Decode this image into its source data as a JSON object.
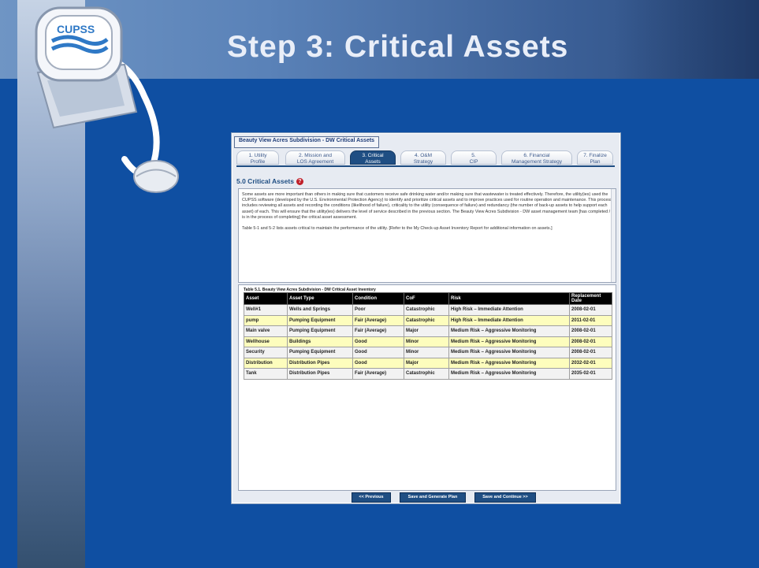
{
  "slide": {
    "title": "Step 3: Critical Assets",
    "logo_text": "CUPSS"
  },
  "app": {
    "title": "Beauty View Acres Subdivision - DW Critical Assets",
    "tabs": [
      {
        "line1": "1. Utility",
        "line2": "Profile",
        "active": false
      },
      {
        "line1": "2. Mission and",
        "line2": "LOS Agreement",
        "active": false
      },
      {
        "line1": "3. Critical",
        "line2": "Assets",
        "active": true
      },
      {
        "line1": "4. O&M",
        "line2": "Strategy",
        "active": false
      },
      {
        "line1": "5.",
        "line2": "CIP",
        "active": false
      },
      {
        "line1": "6. Financial",
        "line2": "Management Strategy",
        "active": false
      },
      {
        "line1": "7. Finalize",
        "line2": "Plan",
        "active": false
      }
    ],
    "section_heading": "5.0 Critical Assets",
    "info_icon": "?",
    "paragraph1": "Some assets are more important than others in making sure that customers receive safe drinking water and/or making sure that wastewater is treated effectively. Therefore, the utility(ies) used the CUPSS software (developed by the U.S. Environmental Protection Agency) to identify and prioritize critical assets and to improve practices used for routine operation and maintenance. This process includes reviewing all assets and recording the conditions (likelihood of failure), criticality to the utility (consequence of failure) and redundancy (the number of back-up assets to help support each asset) of each. This will ensure that the utility(ies) delivers the level of service described in the previous section. The Beauty View Acres Subdivision - DW asset management team [has completed / is in the process of completing] the critical asset assessment.",
    "paragraph2": "Table 5-1 and 5-2 lists assets critical to maintain the performance of the utility. [Refer to the My Check-up Asset Inventory Report for additional information on assets.]",
    "table_caption": "Table 5.1. Beauty View Acres Subdivision - DW Critical Asset Inventory",
    "table_headers": [
      "Asset",
      "Asset Type",
      "Condition",
      "CoF",
      "Risk",
      "Replacement Date"
    ],
    "table_rows": [
      [
        "Well#1",
        "Wells and Springs",
        "Poor",
        "Catastrophic",
        "High Risk – Immediate Attention",
        "2008-02-01"
      ],
      [
        "pump",
        "Pumping Equipment",
        "Fair (Average)",
        "Catastrophic",
        "High Risk – Immediate Attention",
        "2011-02-01"
      ],
      [
        "Main valve",
        "Pumping Equipment",
        "Fair (Average)",
        "Major",
        "Medium Risk – Aggressive Monitoring",
        "2008-02-01"
      ],
      [
        "Wellhouse",
        "Buildings",
        "Good",
        "Minor",
        "Medium Risk – Aggressive Monitoring",
        "2008-02-01"
      ],
      [
        "Security",
        "Pumping Equipment",
        "Good",
        "Minor",
        "Medium Risk – Aggressive Monitoring",
        "2008-02-01"
      ],
      [
        "Distribution",
        "Distribution Pipes",
        "Good",
        "Major",
        "Medium Risk – Aggressive Monitoring",
        "2032-02-01"
      ],
      [
        "Tank",
        "Distribution Pipes",
        "Fair (Average)",
        "Catastrophic",
        "Medium Risk – Aggressive Monitoring",
        "2035-02-01"
      ]
    ],
    "buttons": {
      "previous": "<< Previous",
      "generate": "Save and Generate Plan",
      "continue": "Save and Continue >>"
    }
  },
  "colors": {
    "slide_background": "#0f4fa2",
    "active_tab": "#1f4e83",
    "row_highlight": "#fdfdbd",
    "info_icon": "#c0202a"
  }
}
